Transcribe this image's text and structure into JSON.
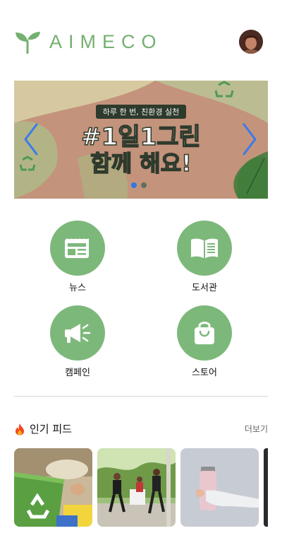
{
  "header": {
    "logo_text": "AIMECO",
    "logo_icon": "sprout-icon",
    "avatar": "user-avatar"
  },
  "banner": {
    "subtitle": "하루 한 번, 친환경 실천",
    "title_line1": "#1일1그린",
    "title_line2": "함께 해요!",
    "slide_count": 2,
    "active_slide": 1,
    "prev_icon": "chevron-left-icon",
    "next_icon": "chevron-right-icon"
  },
  "menu": [
    {
      "label": "뉴스",
      "icon": "newspaper-icon"
    },
    {
      "label": "도서관",
      "icon": "book-icon"
    },
    {
      "label": "캠페인",
      "icon": "megaphone-icon"
    },
    {
      "label": "스토어",
      "icon": "shopping-bag-icon"
    }
  ],
  "feed": {
    "title": "인기 피드",
    "title_icon": "fire-icon",
    "more_label": "더보기",
    "items": [
      {
        "subject": "recycling bin"
      },
      {
        "subject": "plogging runners"
      },
      {
        "subject": "tumbler bottle"
      }
    ]
  },
  "colors": {
    "brand_green": "#74b070",
    "menu_circle": "#7db87b",
    "dot_active": "#2f78e6"
  }
}
